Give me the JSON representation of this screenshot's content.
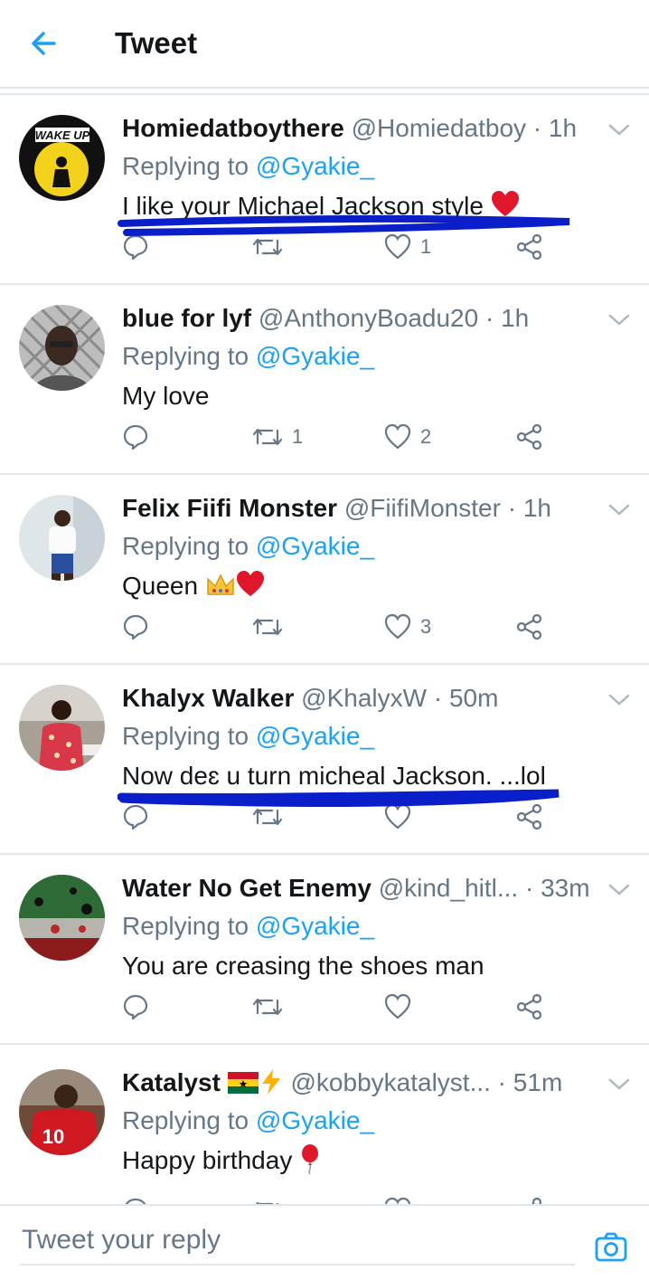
{
  "header": {
    "title": "Tweet"
  },
  "composer": {
    "placeholder": "Tweet your reply"
  },
  "tweets": [
    {
      "name": "Homiedatboythere",
      "handle": "@Homiedatboy",
      "time": "1h",
      "replying_label": "Replying to",
      "replying_to": "@Gyakie_",
      "text": "I like your Michael Jackson style",
      "emoji": "heart-emoji",
      "counts": {
        "reply": "",
        "retweet": "",
        "like": "1"
      },
      "avatar": "wake-up-avatar",
      "avatar_text": "WAKE UP",
      "underlined": true
    },
    {
      "name": "blue for lyf",
      "handle": "@AnthonyBoadu20",
      "time": "1h",
      "replying_label": "Replying to",
      "replying_to": "@Gyakie_",
      "text": "My love",
      "counts": {
        "reply": "",
        "retweet": "1",
        "like": "2"
      },
      "avatar": "man-with-glasses-avatar",
      "underlined": false
    },
    {
      "name": "Felix Fiifi Monster",
      "handle": "@FiifiMonster",
      "time": "1h",
      "replying_label": "Replying to",
      "replying_to": "@Gyakie_",
      "text": "Queen",
      "emoji": "crown-and-heart-emoji",
      "counts": {
        "reply": "",
        "retweet": "",
        "like": "3"
      },
      "avatar": "man-standing-avatar",
      "underlined": false
    },
    {
      "name": "Khalyx Walker",
      "handle": "@KhalyxW",
      "time": "50m",
      "replying_label": "Replying to",
      "replying_to": "@Gyakie_",
      "text": "Now deɛ u turn micheal Jackson. ...lol",
      "counts": {
        "reply": "",
        "retweet": "",
        "like": ""
      },
      "avatar": "man-red-shirt-avatar",
      "underlined": true
    },
    {
      "name": "Water No Get Enemy",
      "handle": "@kind_hitl...",
      "time": "33m",
      "replying_label": "Replying to",
      "replying_to": "@Gyakie_",
      "text": "You are creasing the shoes man",
      "counts": {
        "reply": "",
        "retweet": "",
        "like": ""
      },
      "avatar": "painted-flag-avatar",
      "underlined": false
    },
    {
      "name": "Katalyst",
      "handle": "@kobbykatalyst...",
      "time": "51m",
      "name_emoji": "ghana-flag-and-lightning-emoji",
      "replying_label": "Replying to",
      "replying_to": "@Gyakie_",
      "text": "Happy birthday",
      "emoji": "balloon-emoji",
      "counts": {
        "reply": "",
        "retweet": "",
        "like": ""
      },
      "avatar": "football-player-avatar",
      "avatar_text": "10",
      "underlined": false
    }
  ],
  "colors": {
    "accent": "#1da1f2",
    "secondary_text": "#657786",
    "divider": "#e1e8ed",
    "underline_marker": "#0a1fc9"
  }
}
